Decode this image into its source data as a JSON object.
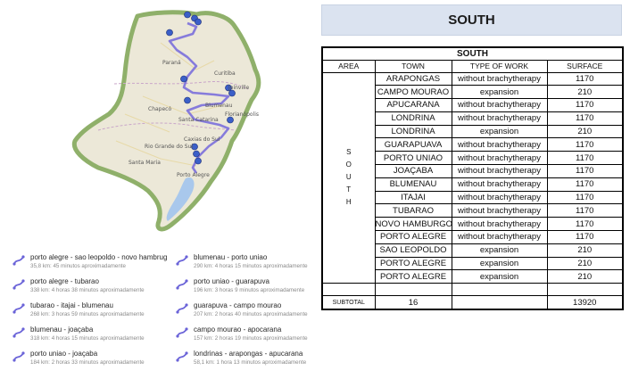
{
  "title_banner": {
    "text": "SOUTH"
  },
  "table": {
    "header_title": "SOUTH",
    "columns": [
      "AREA",
      "TOWN",
      "TYPE OF WORK",
      "SURFACE"
    ],
    "area_label": "SOUTH",
    "area_letters": [
      "S",
      "O",
      "U",
      "T",
      "H"
    ],
    "rows": [
      {
        "town": "ARAPONGAS",
        "work": "without brachytherapy",
        "surface": "1170"
      },
      {
        "town": "CAMPO MOURAO",
        "work": "expansion",
        "surface": "210"
      },
      {
        "town": "APUCARANA",
        "work": "without brachytherapy",
        "surface": "1170"
      },
      {
        "town": "LONDRINA",
        "work": "without brachytherapy",
        "surface": "1170"
      },
      {
        "town": "LONDRINA",
        "work": "expansion",
        "surface": "210"
      },
      {
        "town": "GUARAPUAVA",
        "work": "without brachytherapy",
        "surface": "1170"
      },
      {
        "town": "PORTO UNIAO",
        "work": "without brachytherapy",
        "surface": "1170"
      },
      {
        "town": "JOAÇABA",
        "work": "without brachytherapy",
        "surface": "1170"
      },
      {
        "town": "BLUMENAU",
        "work": "without brachytherapy",
        "surface": "1170"
      },
      {
        "town": "ITAJAI",
        "work": "without brachytherapy",
        "surface": "1170"
      },
      {
        "town": "TUBARAO",
        "work": "without brachytherapy",
        "surface": "1170"
      },
      {
        "town": "NOVO HAMBURGO",
        "work": "without brachytherapy",
        "surface": "1170"
      },
      {
        "town": "PORTO ALEGRE",
        "work": "without brachytherapy",
        "surface": "1170"
      },
      {
        "town": "SAO LEOPOLDO",
        "work": "expansion",
        "surface": "210"
      },
      {
        "town": "PORTO ALEGRE",
        "work": "expansion",
        "surface": "210"
      },
      {
        "town": "PORTO ALEGRE",
        "work": "expansion",
        "surface": "210"
      }
    ],
    "subtotal": {
      "label": "SUBTOTAL",
      "count": "16",
      "surface": "13920"
    }
  },
  "map": {
    "labels": [
      "Paraná",
      "Curitiba",
      "Chapecó",
      "Santa Catarina",
      "Blumenau",
      "Florianópolis",
      "Rio Grande do Sul",
      "Caxias do Sul",
      "Porto Alegre",
      "Santa Maria",
      "Joinville"
    ],
    "colors": {
      "land": "#ece8d8",
      "border": "#8fb06a",
      "route": "#7b6fdc",
      "marker": "#3b5fc8",
      "water": "#a9c8ec"
    }
  },
  "routes": [
    {
      "name": "porto alegre - sao leopoldo - novo hambrug",
      "detail": "35,8 km: 45 minutos aproximadamente",
      "icon": "route-icon"
    },
    {
      "name": "porto alegre - tubarao",
      "detail": "338 km: 4 horas 38 minutos aproximadamente",
      "icon": "route-icon"
    },
    {
      "name": "tubarao - itajai - blumenau",
      "detail": "268 km: 3 horas 59 minutos aproximadamente",
      "icon": "route-icon"
    },
    {
      "name": "blumenau - joaçaba",
      "detail": "318 km: 4 horas 15 minutos aproximadamente",
      "icon": "route-icon"
    },
    {
      "name": "porto uniao - joaçaba",
      "detail": "184 km: 2 horas 33 minutos aproximadamente",
      "icon": "route-icon"
    },
    {
      "name": "blumenau - porto uniao",
      "detail": "290 km: 4 horas 15 minutos aproximadamente",
      "icon": "route-icon"
    },
    {
      "name": "porto uniao - guarapuva",
      "detail": "196 km: 3 horas 9 minutos aproximadamente",
      "icon": "route-icon"
    },
    {
      "name": "guarapuva - campo mourao",
      "detail": "207 km: 2 horas 40 minutos aproximadamente",
      "icon": "route-icon"
    },
    {
      "name": "campo mourao - apocarana",
      "detail": "157 km: 2 horas 19 minutos aproximadamente",
      "icon": "route-icon"
    },
    {
      "name": "londrinas - arapongas - apucarana",
      "detail": "58,1 km: 1 hora 13 minutos aproximadamente",
      "icon": "route-icon"
    }
  ]
}
